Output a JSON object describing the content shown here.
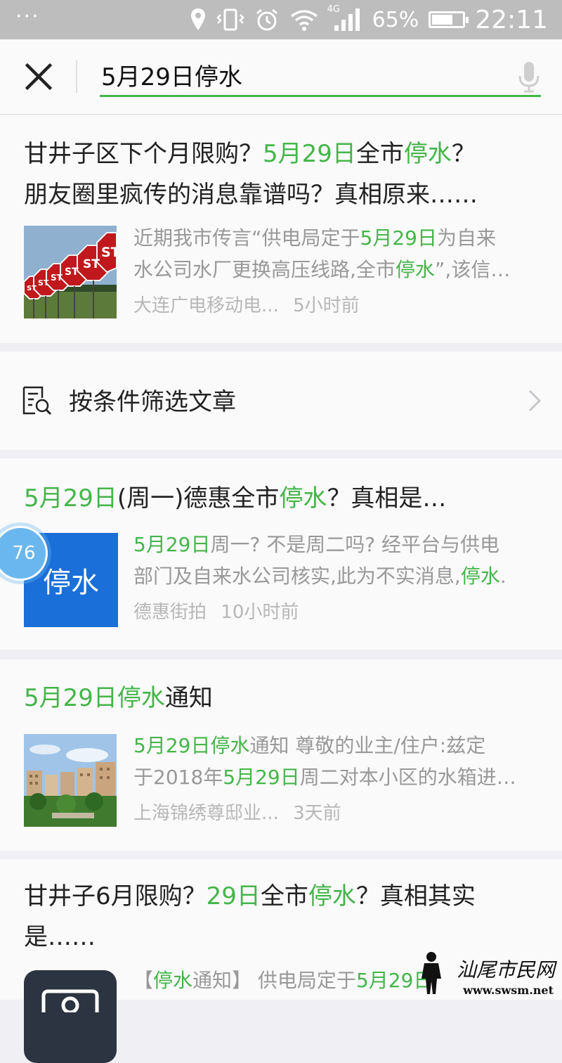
{
  "status_bar": {
    "battery_percent": "65%",
    "battery_level": 0.65,
    "network": "4G",
    "time": "22:11"
  },
  "search": {
    "query": "5月29日停水",
    "close_icon": "close-icon",
    "mic_icon": "mic-icon"
  },
  "results": [
    {
      "title": [
        {
          "t": "甘井子区下个月限购？",
          "hl": false
        },
        {
          "t": "5月29日",
          "hl": true
        },
        {
          "t": "全市",
          "hl": false
        },
        {
          "t": "停水",
          "hl": true
        },
        {
          "t": "？",
          "hl": false
        }
      ],
      "title_line2": "朋友圈里疯传的消息靠谱吗？真相原来……",
      "desc_line1": [
        {
          "t": "近期我市传言“供电局定于",
          "hl": false
        },
        {
          "t": "5月29日",
          "hl": true
        },
        {
          "t": "为自来",
          "hl": false
        }
      ],
      "desc_line2": [
        {
          "t": "水公司水厂更换高压线路,全市",
          "hl": false
        },
        {
          "t": "停水",
          "hl": true
        },
        {
          "t": "”,该信…",
          "hl": false
        }
      ],
      "source": "大连广电移动电...",
      "time": "5小时前",
      "thumb": "stop-signs-image"
    },
    {
      "title": [
        {
          "t": "5月29日",
          "hl": true
        },
        {
          "t": "(周一)德惠全市",
          "hl": false
        },
        {
          "t": "停水",
          "hl": true
        },
        {
          "t": "？真相是…",
          "hl": false
        }
      ],
      "desc_line1": [
        {
          "t": "5月29日",
          "hl": true
        },
        {
          "t": "周一? 不是周二吗? 经平台与供电",
          "hl": false
        }
      ],
      "desc_line2": [
        {
          "t": "部门及自来水公司核实,此为不实消息,",
          "hl": false
        },
        {
          "t": "停水",
          "hl": true
        },
        {
          "t": ".",
          "hl": false
        }
      ],
      "thumb_text": "停水",
      "source": "德惠街拍",
      "time": "10小时前"
    },
    {
      "title": [
        {
          "t": "5月29日",
          "hl": true
        },
        {
          "t": "停水",
          "hl": true
        },
        {
          "t": "通知",
          "hl": false
        }
      ],
      "desc_line1": [
        {
          "t": "5月29日",
          "hl": true
        },
        {
          "t": "停水",
          "hl": true
        },
        {
          "t": "通知 尊敬的业主/住户:兹定",
          "hl": false
        }
      ],
      "desc_line2": [
        {
          "t": "于2018年",
          "hl": false
        },
        {
          "t": "5月29日",
          "hl": true
        },
        {
          "t": "周二对本小区的水箱进…",
          "hl": false
        }
      ],
      "source": "上海锦绣尊邸业...",
      "time": "3天前",
      "thumb": "residential-buildings-image"
    },
    {
      "title": [
        {
          "t": "甘井子6月限购？",
          "hl": false
        },
        {
          "t": "29日",
          "hl": true
        },
        {
          "t": "全市",
          "hl": false
        },
        {
          "t": "停水",
          "hl": true
        },
        {
          "t": "？真相其实",
          "hl": false
        }
      ],
      "title_line2": "是……",
      "desc_line1": [
        {
          "t": "【",
          "hl": false
        },
        {
          "t": "停水",
          "hl": true
        },
        {
          "t": "通知】 供电局定于",
          "hl": false
        },
        {
          "t": "5月29日",
          "hl": true
        }
      ],
      "thumb": "camera-app-icon"
    }
  ],
  "filter": {
    "label": "按条件筛选文章",
    "icon": "document-search-icon"
  },
  "badge": {
    "count": "76"
  },
  "watermark": {
    "cn": "汕尾市民网",
    "url": "www.swsm.net"
  },
  "colors": {
    "highlight": "#44b549",
    "thumb_blue": "#1a6fd8",
    "status_bar": "#bdbdbd"
  }
}
